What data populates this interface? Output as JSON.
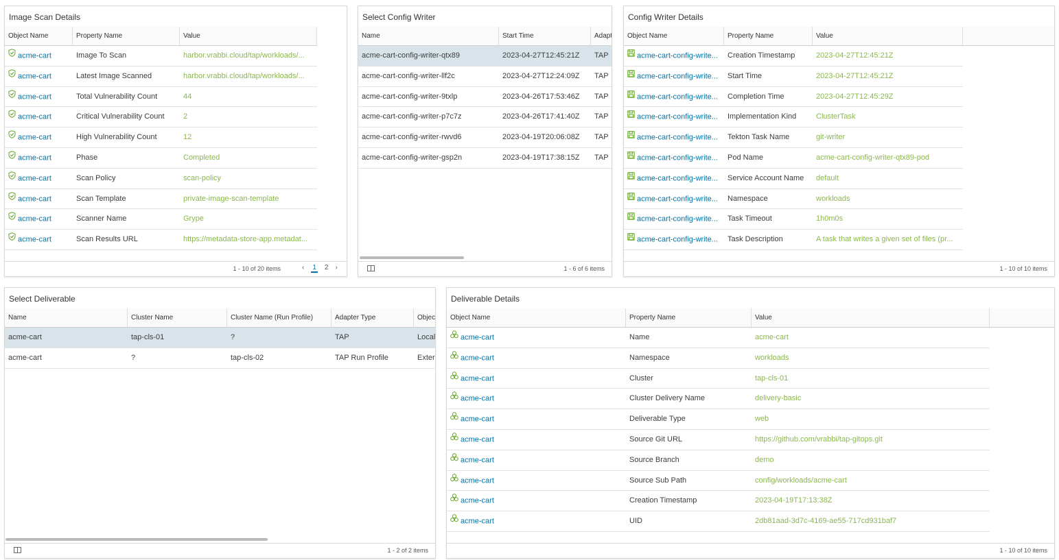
{
  "image_scan": {
    "title": "Image Scan Details",
    "columns": [
      "Object Name",
      "Property Name",
      "Value"
    ],
    "rows": [
      {
        "object": "acme-cart",
        "property": "Image To Scan",
        "value": "harbor.vrabbi.cloud/tap/workloads/..."
      },
      {
        "object": "acme-cart",
        "property": "Latest Image Scanned",
        "value": "harbor.vrabbi.cloud/tap/workloads/..."
      },
      {
        "object": "acme-cart",
        "property": "Total Vulnerability Count",
        "value": "44"
      },
      {
        "object": "acme-cart",
        "property": "Critical Vulnerability Count",
        "value": "2"
      },
      {
        "object": "acme-cart",
        "property": "High Vulnerability Count",
        "value": "12"
      },
      {
        "object": "acme-cart",
        "property": "Phase",
        "value": "Completed"
      },
      {
        "object": "acme-cart",
        "property": "Scan Policy",
        "value": "scan-policy"
      },
      {
        "object": "acme-cart",
        "property": "Scan Template",
        "value": "private-image-scan-template"
      },
      {
        "object": "acme-cart",
        "property": "Scanner Name",
        "value": "Grype"
      },
      {
        "object": "acme-cart",
        "property": "Scan Results URL",
        "value": "https://metadata-store-app.metadat..."
      }
    ],
    "footer": "1 - 10 of 20 items",
    "pager": {
      "prev": "‹",
      "pages": [
        "1",
        "2"
      ],
      "next": "›"
    }
  },
  "config_writer_select": {
    "title": "Select Config Writer",
    "columns": [
      "Name",
      "Start Time",
      "Adapt"
    ],
    "rows": [
      {
        "name": "acme-cart-config-writer-qtx89",
        "start": "2023-04-27T12:45:21Z",
        "adapter": "TAP"
      },
      {
        "name": "acme-cart-config-writer-llf2c",
        "start": "2023-04-27T12:24:09Z",
        "adapter": "TAP"
      },
      {
        "name": "acme-cart-config-writer-9txlp",
        "start": "2023-04-26T17:53:46Z",
        "adapter": "TAP"
      },
      {
        "name": "acme-cart-config-writer-p7c7z",
        "start": "2023-04-26T17:41:40Z",
        "adapter": "TAP"
      },
      {
        "name": "acme-cart-config-writer-rwvd6",
        "start": "2023-04-19T20:06:08Z",
        "adapter": "TAP"
      },
      {
        "name": "acme-cart-config-writer-gsp2n",
        "start": "2023-04-19T17:38:15Z",
        "adapter": "TAP"
      }
    ],
    "footer": "1 - 6 of 6 items"
  },
  "config_writer_details": {
    "title": "Config Writer Details",
    "columns": [
      "Object Name",
      "Property Name",
      "Value"
    ],
    "rows": [
      {
        "object": "acme-cart-config-write...",
        "property": "Creation Timestamp",
        "value": "2023-04-27T12:45:21Z"
      },
      {
        "object": "acme-cart-config-write...",
        "property": "Start Time",
        "value": "2023-04-27T12:45:21Z"
      },
      {
        "object": "acme-cart-config-write...",
        "property": "Completion Time",
        "value": "2023-04-27T12:45:29Z"
      },
      {
        "object": "acme-cart-config-write...",
        "property": "Implementation Kind",
        "value": "ClusterTask"
      },
      {
        "object": "acme-cart-config-write...",
        "property": "Tekton Task Name",
        "value": "git-writer"
      },
      {
        "object": "acme-cart-config-write...",
        "property": "Pod Name",
        "value": "acme-cart-config-writer-qtx89-pod"
      },
      {
        "object": "acme-cart-config-write...",
        "property": "Service Account Name",
        "value": "default"
      },
      {
        "object": "acme-cart-config-write...",
        "property": "Namespace",
        "value": "workloads"
      },
      {
        "object": "acme-cart-config-write...",
        "property": "Task Timeout",
        "value": "1h0m0s"
      },
      {
        "object": "acme-cart-config-write...",
        "property": "Task Description",
        "value": "A task that writes a given set of files (pr..."
      }
    ],
    "footer": "1 - 10 of 10 items"
  },
  "deliverable_select": {
    "title": "Select Deliverable",
    "columns": [
      "Name",
      "Cluster Name",
      "Cluster Name (Run Profile)",
      "Adapter Type",
      "Objec"
    ],
    "rows": [
      {
        "name": "acme-cart",
        "cluster": "tap-cls-01",
        "cluster_run": "?",
        "adapter": "TAP",
        "object": "Local"
      },
      {
        "name": "acme-cart",
        "cluster": "?",
        "cluster_run": "tap-cls-02",
        "adapter": "TAP Run Profile",
        "object": "Exter"
      }
    ],
    "footer": "1 - 2 of 2 items"
  },
  "deliverable_details": {
    "title": "Deliverable Details",
    "columns": [
      "Object Name",
      "Property Name",
      "Value"
    ],
    "rows": [
      {
        "object": "acme-cart",
        "property": "Name",
        "value": "acme-cart"
      },
      {
        "object": "acme-cart",
        "property": "Namespace",
        "value": "workloads"
      },
      {
        "object": "acme-cart",
        "property": "Cluster",
        "value": "tap-cls-01"
      },
      {
        "object": "acme-cart",
        "property": "Cluster Delivery Name",
        "value": "delivery-basic"
      },
      {
        "object": "acme-cart",
        "property": "Deliverable Type",
        "value": "web"
      },
      {
        "object": "acme-cart",
        "property": "Source Git URL",
        "value": "https://github.com/vrabbi/tap-gitops.git"
      },
      {
        "object": "acme-cart",
        "property": "Source Branch",
        "value": "demo"
      },
      {
        "object": "acme-cart",
        "property": "Source Sub Path",
        "value": "config/workloads/acme-cart"
      },
      {
        "object": "acme-cart",
        "property": "Creation Timestamp",
        "value": "2023-04-19T17:13:38Z"
      },
      {
        "object": "acme-cart",
        "property": "UID",
        "value": "2db81aad-3d7c-4169-ae55-717cd931baf7"
      }
    ],
    "footer": "1 - 10 of 10 items"
  },
  "colors": {
    "link": "#0072a3",
    "value": "#8ab74c",
    "selected_row": "#d9e4ea",
    "icon_green": "#62a420"
  },
  "icons": {
    "scan": "shield-check-icon",
    "config": "save-disk-icon",
    "deliverable": "cluster-circles-icon"
  }
}
